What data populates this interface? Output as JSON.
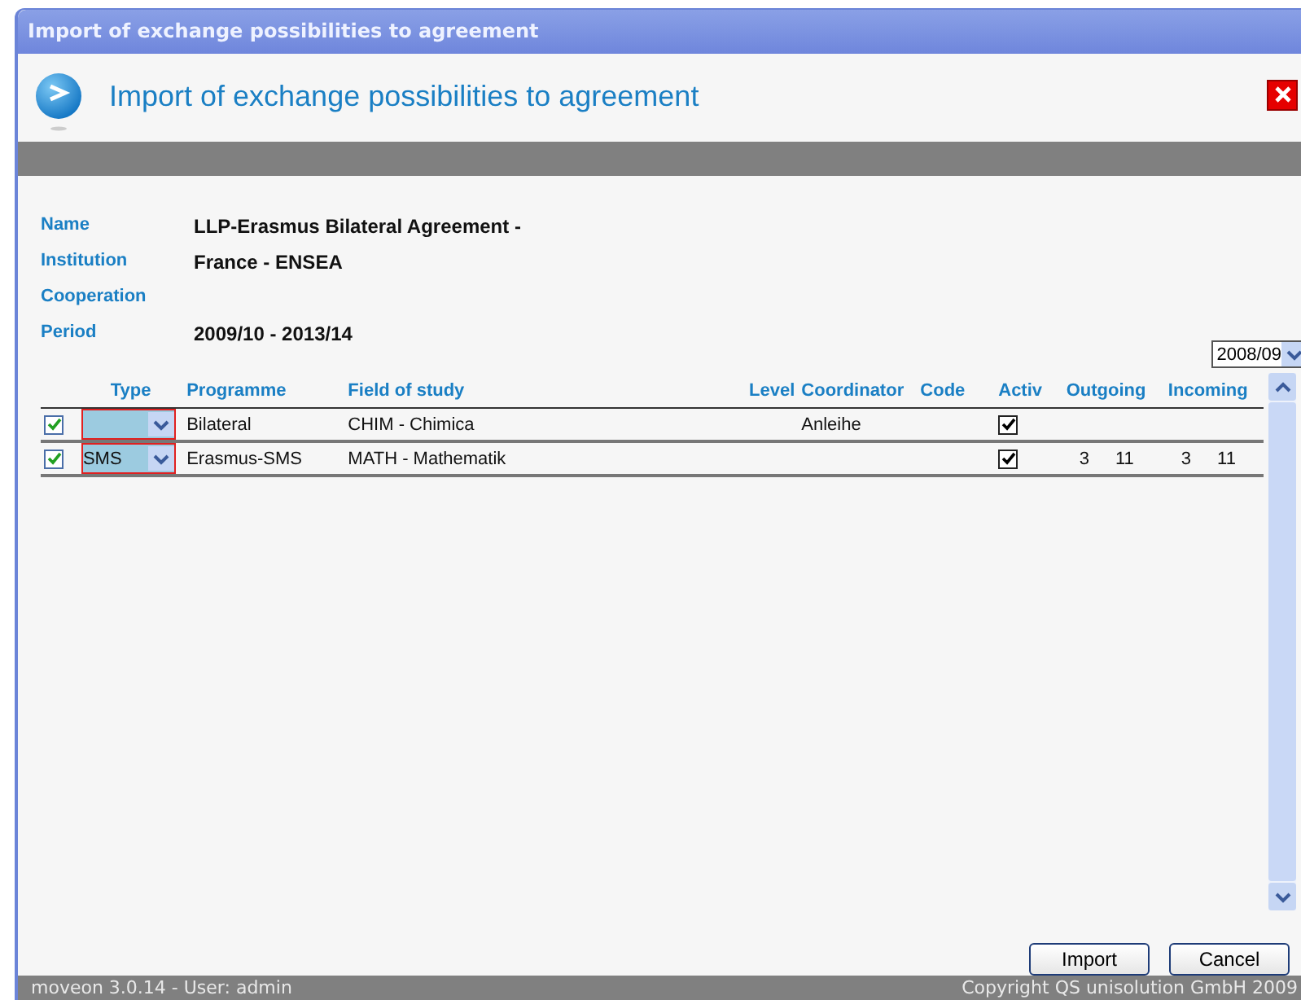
{
  "window": {
    "title": "Import of exchange possibilities to agreement"
  },
  "header": {
    "title": "Import of exchange possibilities to agreement"
  },
  "details": [
    {
      "label": "Name",
      "value": "LLP-Erasmus Bilateral Agreement -"
    },
    {
      "label": "Institution",
      "value": "France - ENSEA"
    },
    {
      "label": "Cooperation"
    },
    {
      "label": "Period",
      "value": "2009/10 - 2013/14"
    }
  ],
  "year_select": {
    "value": "2008/09"
  },
  "table": {
    "columns": [
      "Type",
      "Programme",
      "Field of study",
      "Level",
      "Coordinator",
      "Code",
      "Activ",
      "Outgoing",
      "Incoming"
    ],
    "rows": [
      {
        "checked": true,
        "programme": "Bilateral",
        "field": "CHIM - Chimica",
        "coordinator": "Anleihe",
        "active": true
      },
      {
        "checked": true,
        "type": "SMS",
        "programme": "Erasmus-SMS",
        "field": "MATH - Mathematik",
        "active": true,
        "outgoing": [
          "3",
          "11"
        ],
        "incoming": [
          "3",
          "11"
        ]
      }
    ]
  },
  "buttons": [
    "Import",
    "Cancel"
  ],
  "status_bar": {
    "left": "moveon 3.0.14 - User: admin",
    "right": "Copyright QS unisolution GmbH 2009"
  }
}
